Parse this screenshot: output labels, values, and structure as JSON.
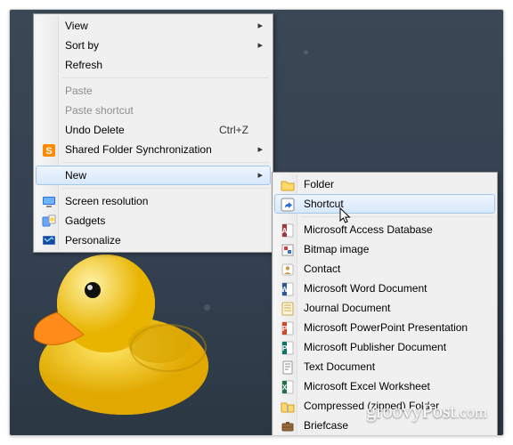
{
  "watermark": {
    "brand": "groovy",
    "suffix": "Post",
    "tld": ".com"
  },
  "context_menu": {
    "view": "View",
    "sort": "Sort by",
    "refresh": "Refresh",
    "paste": "Paste",
    "paste_shortcut": "Paste shortcut",
    "undo": "Undo Delete",
    "undo_accel": "Ctrl+Z",
    "sync": "Shared Folder Synchronization",
    "new": "New",
    "screen_res": "Screen resolution",
    "gadgets": "Gadgets",
    "personalize": "Personalize"
  },
  "new_submenu": {
    "folder": "Folder",
    "shortcut": "Shortcut",
    "access": "Microsoft Access Database",
    "bitmap": "Bitmap image",
    "contact": "Contact",
    "word": "Microsoft Word Document",
    "journal": "Journal Document",
    "powerpoint": "Microsoft PowerPoint Presentation",
    "publisher": "Microsoft Publisher Document",
    "text": "Text Document",
    "excel": "Microsoft Excel Worksheet",
    "zip": "Compressed (zipped) Folder",
    "briefcase": "Briefcase"
  },
  "icons": {
    "sync": "sync-icon",
    "screen_res": "screen-resolution-icon",
    "gadgets": "gadgets-icon",
    "personalize": "personalize-icon",
    "folder": "folder-icon",
    "shortcut": "shortcut-icon",
    "access": "access-icon",
    "bitmap": "bitmap-icon",
    "contact": "contact-icon",
    "word": "word-icon",
    "journal": "journal-icon",
    "powerpoint": "powerpoint-icon",
    "publisher": "publisher-icon",
    "text": "text-icon",
    "excel": "excel-icon",
    "zip": "zip-icon",
    "briefcase": "briefcase-icon"
  }
}
